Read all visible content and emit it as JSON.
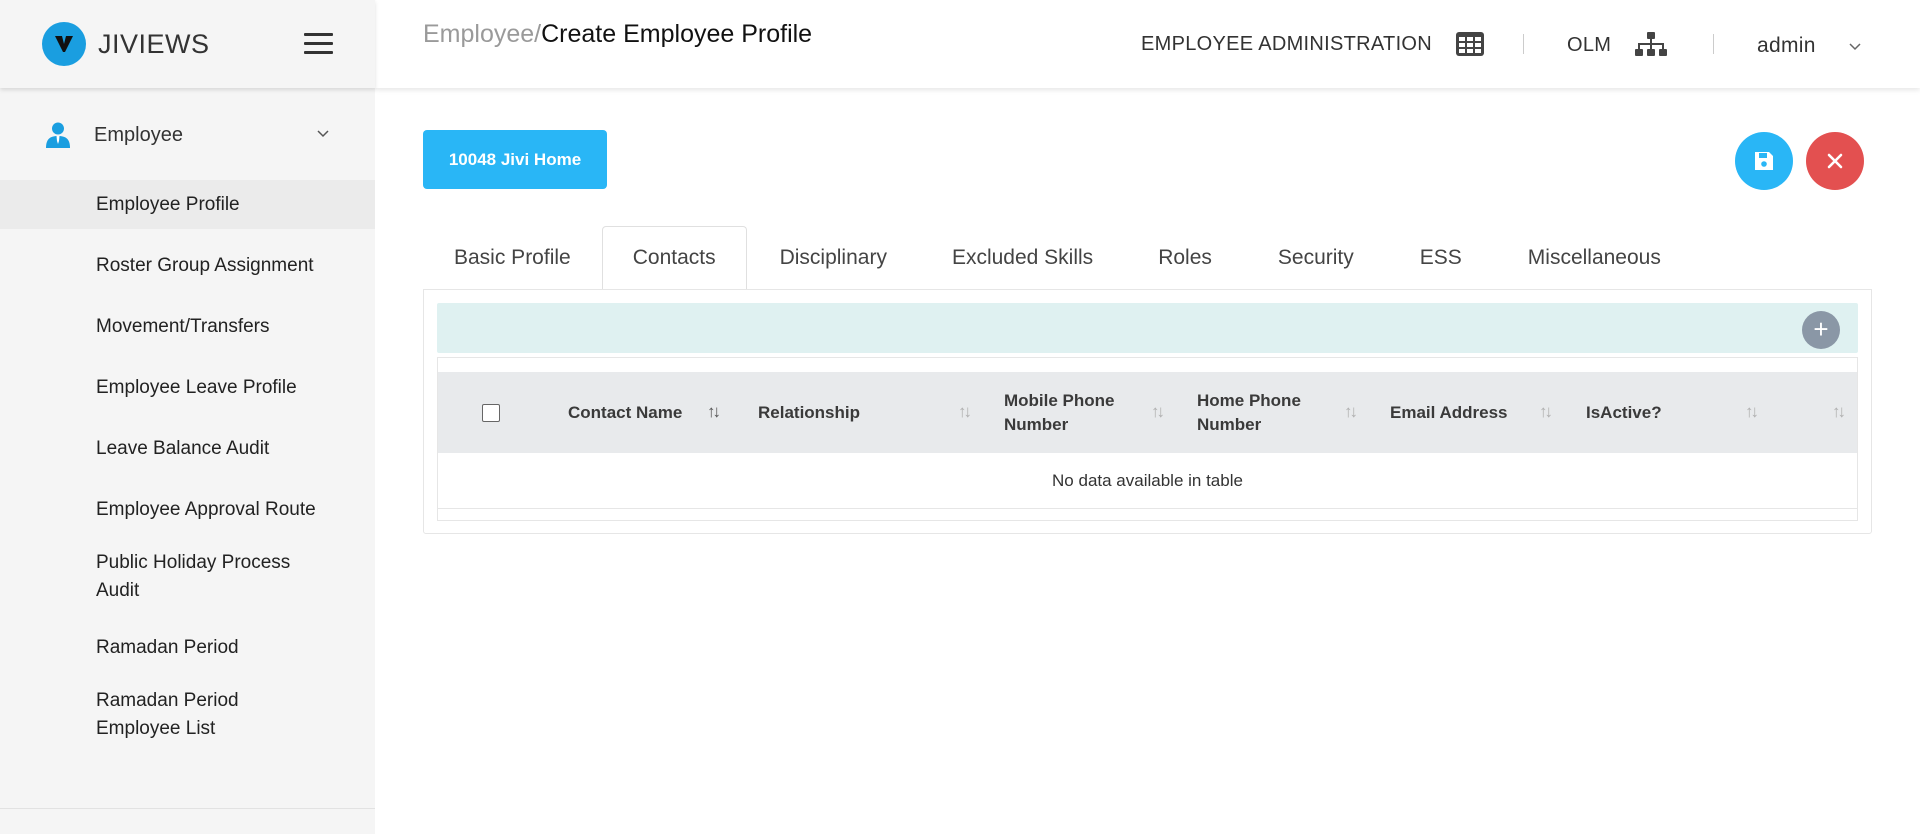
{
  "app": {
    "name": "JIVIEWS",
    "logo_letter": "V"
  },
  "sidebar": {
    "group_label": "Employee",
    "items": [
      {
        "label": "Employee Profile",
        "active": true
      },
      {
        "label": "Roster Group Assignment"
      },
      {
        "label": "Movement/Transfers"
      },
      {
        "label": "Employee Leave Profile"
      },
      {
        "label": "Leave Balance Audit"
      },
      {
        "label": "Employee Approval Route"
      },
      {
        "label": "Public Holiday Process Audit"
      },
      {
        "label": "Ramadan Period"
      },
      {
        "label": "Ramadan Period Employee List"
      }
    ]
  },
  "header": {
    "breadcrumb_parent": "Employee/",
    "breadcrumb_current": "Create Employee Profile",
    "module_label": "EMPLOYEE ADMINISTRATION",
    "org_label": "OLM",
    "user_label": "admin"
  },
  "employee_button": "10048 Jivi Home",
  "tabs": [
    {
      "label": "Basic Profile"
    },
    {
      "label": "Contacts",
      "active": true
    },
    {
      "label": "Disciplinary"
    },
    {
      "label": "Excluded Skills"
    },
    {
      "label": "Roles"
    },
    {
      "label": "Security"
    },
    {
      "label": "ESS"
    },
    {
      "label": "Miscellaneous"
    }
  ],
  "table": {
    "add_symbol": "+",
    "columns": [
      {
        "label": "Contact Name"
      },
      {
        "label": "Relationship"
      },
      {
        "label": "Mobile Phone Number"
      },
      {
        "label": "Home Phone Number"
      },
      {
        "label": "Email Address"
      },
      {
        "label": "IsActive?"
      }
    ],
    "empty_message": "No data available in table"
  },
  "colors": {
    "accent": "#29b6f6",
    "danger": "#e35050",
    "logo": "#1a9ee0",
    "toolbar": "#dff1f1"
  },
  "icons": [
    "menu-icon",
    "person-icon",
    "chevron-down-icon",
    "grid-icon",
    "org-chart-icon",
    "save-icon",
    "close-icon",
    "plus-icon",
    "sort-icon"
  ]
}
